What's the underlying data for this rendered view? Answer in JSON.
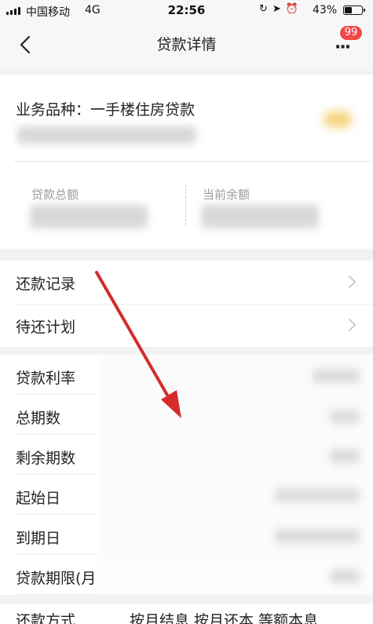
{
  "status_bar": {
    "carrier": "中国移动",
    "network": "4G",
    "time": "22:56",
    "battery_percent": "43%",
    "battery_level": 0.43
  },
  "nav": {
    "title": "贷款详情",
    "badge_count": "99"
  },
  "loan_card": {
    "product_label": "业务品种：一手楼住房贷款",
    "total_amount_label": "贷款总额",
    "current_balance_label": "当前余额"
  },
  "links": [
    {
      "label": "还款记录"
    },
    {
      "label": "待还计划"
    }
  ],
  "details": [
    {
      "label": "贷款利率"
    },
    {
      "label": "总期数"
    },
    {
      "label": "剩余期数"
    },
    {
      "label": "起始日"
    },
    {
      "label": "到期日"
    },
    {
      "label": "贷款期限(月"
    }
  ],
  "repayment": {
    "label": "还款方式",
    "options": "按月结息  按月还本  等额本息"
  },
  "colors": {
    "badge": "#f04848",
    "annotation_arrow": "#d62b2b",
    "page_background": "#f2f2f2"
  }
}
